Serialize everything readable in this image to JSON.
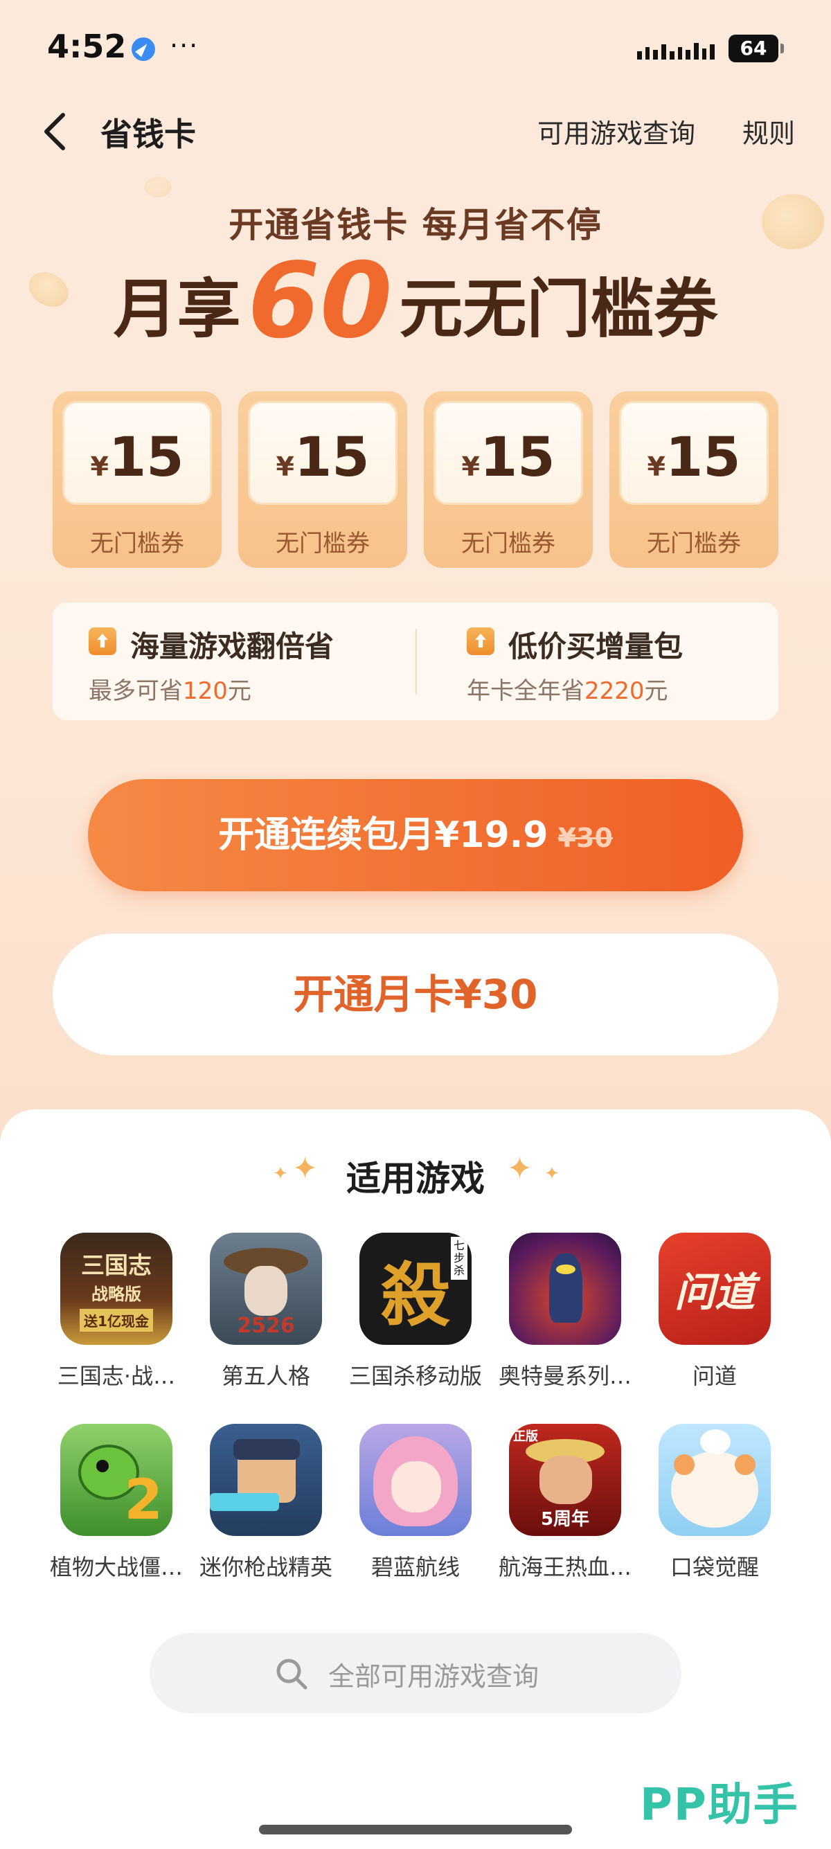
{
  "status_bar": {
    "time": "4:52",
    "dots": "···",
    "battery": "64"
  },
  "nav": {
    "title": "省钱卡",
    "query_link": "可用游戏查询",
    "rules_link": "规则"
  },
  "hero": {
    "subtitle": "开通省钱卡  每月省不停",
    "main_prefix": "月享",
    "main_amount": "60",
    "main_suffix": "元无门槛券"
  },
  "coupons": [
    {
      "currency": "¥",
      "value": "15",
      "label": "无门槛券"
    },
    {
      "currency": "¥",
      "value": "15",
      "label": "无门槛券"
    },
    {
      "currency": "¥",
      "value": "15",
      "label": "无门槛券"
    },
    {
      "currency": "¥",
      "value": "15",
      "label": "无门槛券"
    }
  ],
  "benefits": [
    {
      "title": "海量游戏翻倍省",
      "desc_prefix": "最多可省",
      "desc_highlight": "120",
      "desc_suffix": "元"
    },
    {
      "title": "低价买增量包",
      "desc_prefix": "年卡全年省",
      "desc_highlight": "2220",
      "desc_suffix": "元"
    }
  ],
  "buttons": {
    "primary_label": "开通连续包月¥19.9",
    "primary_original": "¥30",
    "secondary_label": "开通月卡¥30"
  },
  "games_section": {
    "title": "适用游戏",
    "games": [
      {
        "name": "三国志·战…",
        "icon": "sanguozhi-icon"
      },
      {
        "name": "第五人格",
        "icon": "identity-v-icon"
      },
      {
        "name": "三国杀移动版",
        "icon": "sanguosha-icon"
      },
      {
        "name": "奥特曼系列…",
        "icon": "ultraman-icon"
      },
      {
        "name": "问道",
        "icon": "wendao-icon"
      },
      {
        "name": "植物大战僵…",
        "icon": "pvz-icon"
      },
      {
        "name": "迷你枪战精英",
        "icon": "mini-gun-icon"
      },
      {
        "name": "碧蓝航线",
        "icon": "azur-lane-icon"
      },
      {
        "name": "航海王热血…",
        "icon": "one-piece-icon"
      },
      {
        "name": "口袋觉醒",
        "icon": "pocket-awaken-icon"
      }
    ]
  },
  "search": {
    "placeholder": "全部可用游戏查询"
  },
  "watermark": "PP助手",
  "colors": {
    "accent": "#ef5e25",
    "accent_text": "#e0632a",
    "brand_brown": "#4a2817"
  },
  "game_icon_labels": {
    "sanguozhi": "三国志",
    "sanguozhi_sub": "战略版",
    "sanguozhi_banner": "送1亿现金",
    "identity_v_num": "2526",
    "sanguosha_char": "殺",
    "sanguosha_tag": "七步杀",
    "wendao_chars": "问道",
    "pvz_num": "2",
    "one_piece_tag": "正版",
    "one_piece_anniv": "5周年"
  }
}
